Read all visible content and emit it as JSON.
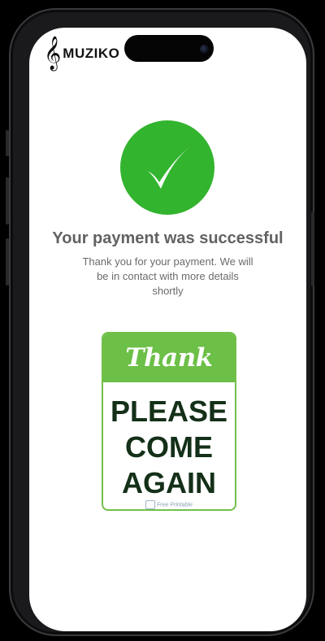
{
  "app": {
    "brand": "MUZIKO",
    "logo_icon": "treble-clef-icon"
  },
  "status": {
    "title": "Your payment was successful",
    "message": "Thank you for your payment. We will be in contact with more details shortly",
    "icon": "check-icon",
    "accent_color": "#33b42f"
  },
  "sign": {
    "header": "Thank You",
    "line1": "PLEASE",
    "line2": "COME",
    "line3": "AGAIN",
    "watermark": "Free Printable",
    "header_color": "#6cbf47",
    "text_color": "#143018"
  }
}
